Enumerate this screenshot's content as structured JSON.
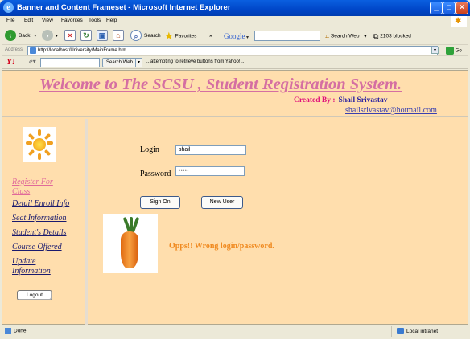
{
  "window": {
    "title": "Banner and Content Frameset - Microsoft Internet Explorer",
    "minimize": "_",
    "maximize": "□",
    "close": "×"
  },
  "menu": [
    "File",
    "Edit",
    "View",
    "Favorites",
    "Tools",
    "Help"
  ],
  "toolbar": {
    "back": "Back",
    "search": "Search",
    "favorites": "Favorites",
    "more": "»",
    "google_label": "Google",
    "search_web": "Search Web",
    "blocked": "2103 blocked"
  },
  "address": {
    "label": "Address",
    "url": "http://localhost/University/MainFrame.htm",
    "go": "Go"
  },
  "yahoo": {
    "logo": "Y!",
    "search_button": "Search Web",
    "message": "...attempting to retrieve buttons from Yahoo!..."
  },
  "banner": {
    "welcome": "Welcome to The SCSU , Student Registration System.",
    "created_label": "Created By :",
    "author": "Shail Srivastav",
    "email": "shailsrivastav@hotmail.com"
  },
  "nav": {
    "items": [
      {
        "label": "Register For Class",
        "active": true
      },
      {
        "label": "Detail Enroll Info",
        "active": false
      },
      {
        "label": "Seat Information",
        "active": false
      },
      {
        "label": "Student's Details",
        "active": false
      },
      {
        "label": "Course Offered",
        "active": false
      },
      {
        "label": "Update Information",
        "active": false
      }
    ],
    "logout": "Logout"
  },
  "login": {
    "login_label": "Login",
    "login_value": "shail",
    "password_label": "Password",
    "password_value": "•••••",
    "sign_on": "Sign On",
    "new_user": "New User",
    "error": "Opps!! Wrong login/password."
  },
  "status": {
    "text": "Done",
    "zone": "Local intranet"
  },
  "colors": {
    "page_bg": "#ffdead",
    "welcome": "#d56ea2",
    "error": "#f08a20",
    "xp_blue": "#0046c8"
  }
}
